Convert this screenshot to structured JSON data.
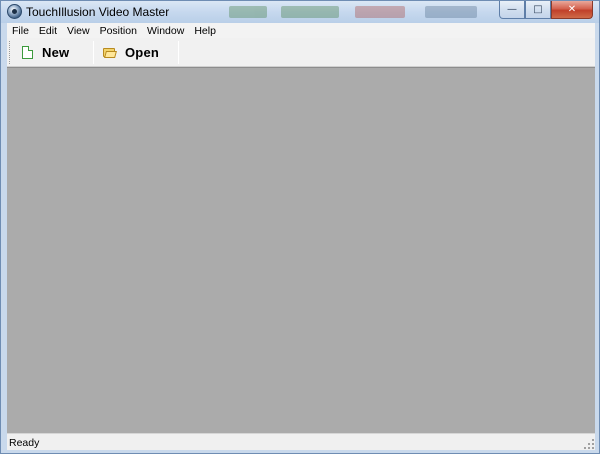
{
  "window": {
    "title": "TouchIllusion Video Master",
    "controls": {
      "minimize": "—",
      "maximize": "□",
      "close": "✕"
    }
  },
  "menubar": {
    "items": [
      "File",
      "Edit",
      "View",
      "Position",
      "Window",
      "Help"
    ]
  },
  "toolbar": {
    "new": {
      "label": "New",
      "icon": "new-document-icon"
    },
    "open": {
      "label": "Open",
      "icon": "open-folder-icon"
    }
  },
  "statusbar": {
    "text": "Ready"
  },
  "colors": {
    "client_area": "#ababab",
    "toolbar": "#f1f1f1",
    "titlebar": "#c6d8ee",
    "close_button": "#c0402a"
  }
}
